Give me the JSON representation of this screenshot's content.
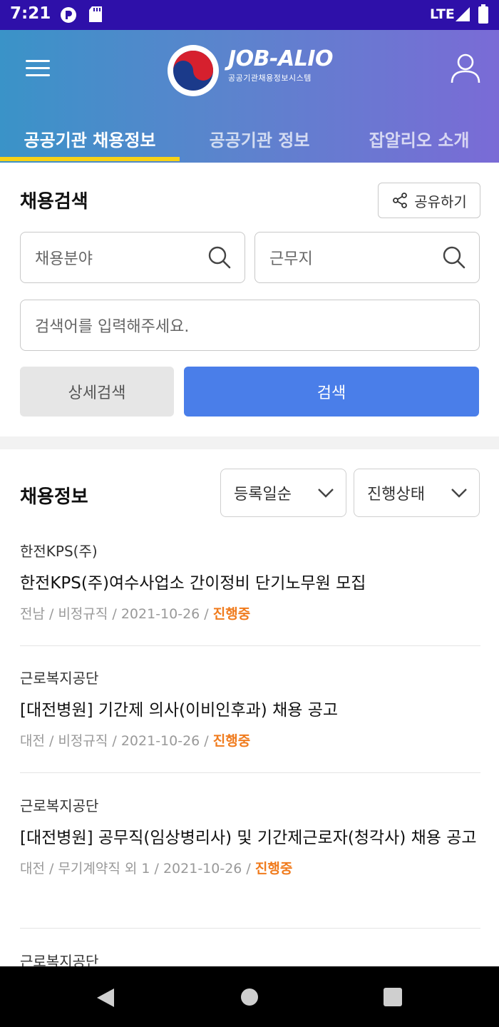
{
  "status_bar": {
    "time": "7:21",
    "network": "LTE"
  },
  "header": {
    "brand_name": "JOB-ALIO",
    "brand_sub": "공공기관채용정보시스템",
    "tabs": [
      {
        "label": "공공기관 채용정보",
        "active": true
      },
      {
        "label": "공공기관 정보",
        "active": false
      },
      {
        "label": "잡알리오 소개",
        "active": false
      }
    ],
    "tab_indicator_color": "#f7d217"
  },
  "search": {
    "title": "채용검색",
    "share_label": "공유하기",
    "field_placeholder": "채용분야",
    "location_placeholder": "근무지",
    "keyword_placeholder": "검색어를 입력해주세요.",
    "detail_button": "상세검색",
    "search_button": "검색",
    "accent_color": "#4a7ee9"
  },
  "listing": {
    "title": "채용정보",
    "sort_label": "등록일순",
    "status_filter_label": "진행상태",
    "status_color": "#f07b1d",
    "jobs": [
      {
        "org": "한전KPS(주)",
        "title": "한전KPS(주)여수사업소 간이정비 단기노무원 모집",
        "meta": "전남 / 비정규직 / 2021-10-26 / ",
        "status": "진행중"
      },
      {
        "org": "근로복지공단",
        "title": "[대전병원] 기간제 의사(이비인후과) 채용 공고",
        "meta": "대전 / 비정규직 / 2021-10-26 / ",
        "status": "진행중"
      },
      {
        "org": "근로복지공단",
        "title": "[대전병원] 공무직(임상병리사) 및 기간제근로자(청각사) 채용 공고",
        "meta": "대전 / 무기계약직 외 1 / 2021-10-26 / ",
        "status": "진행중"
      },
      {
        "org": "근로복지공단"
      }
    ]
  }
}
